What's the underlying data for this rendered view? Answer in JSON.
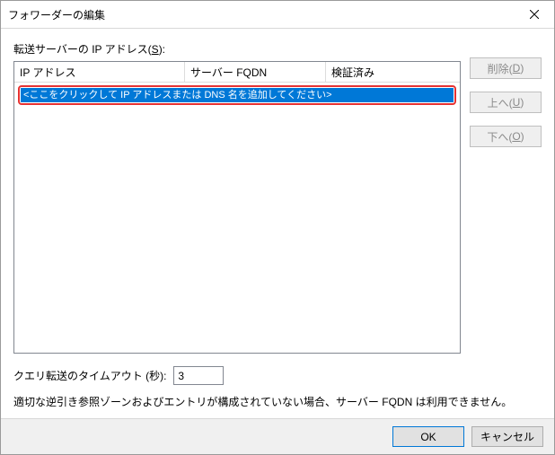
{
  "window": {
    "title": "フォワーダーの編集"
  },
  "labels": {
    "forwarding_servers": "転送サーバーの IP アドレス(",
    "forwarding_servers_key": "S",
    "forwarding_servers_end": "):"
  },
  "table": {
    "headers": {
      "ip": "IP アドレス",
      "fqdn": "サーバー FQDN",
      "verified": "検証済み"
    },
    "placeholder": "<ここをクリックして IP アドレスまたは DNS 名を追加してください>"
  },
  "buttons": {
    "delete": "削除(",
    "delete_key": "D",
    "delete_end": ")",
    "up": "上へ(",
    "up_key": "U",
    "up_end": ")",
    "down": "下へ(",
    "down_key": "O",
    "down_end": ")",
    "ok": "OK",
    "cancel": "キャンセル"
  },
  "timeout": {
    "label": "クエリ転送のタイムアウト (秒):",
    "value": "3"
  },
  "note": "適切な逆引き参照ゾーンおよびエントリが構成されていない場合、サーバー FQDN は利用できません。"
}
